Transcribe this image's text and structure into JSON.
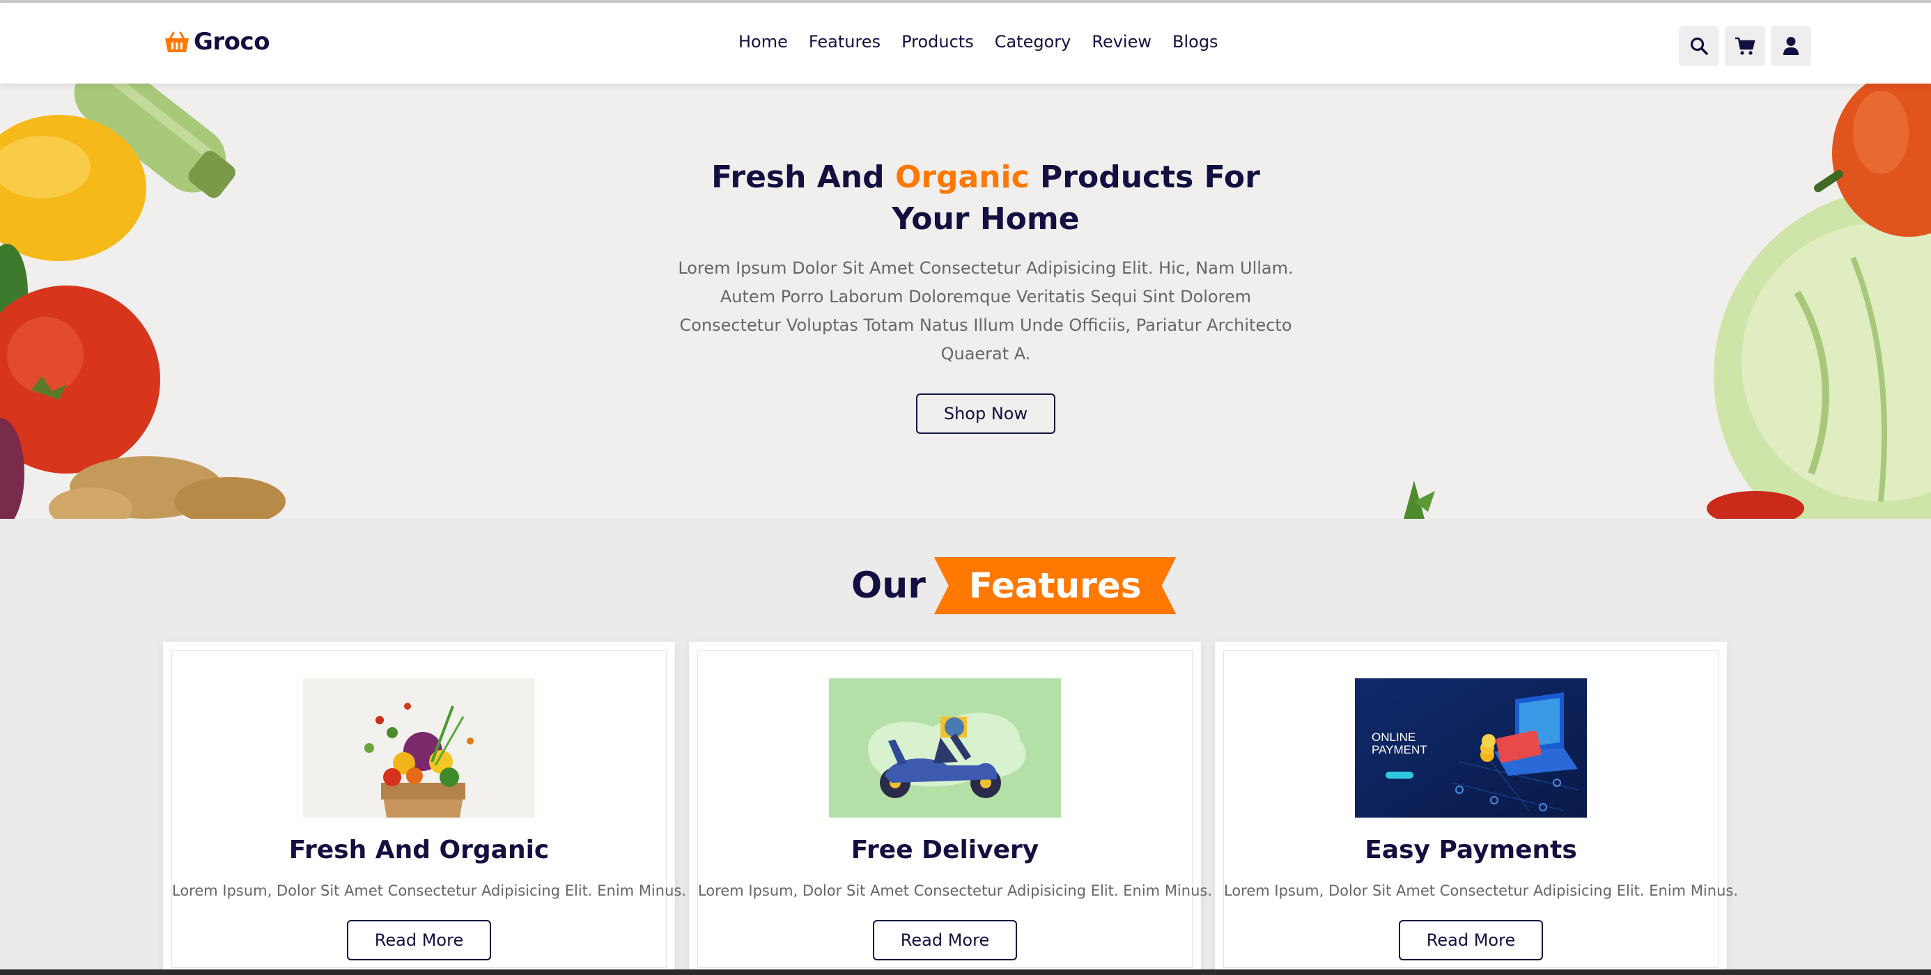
{
  "header": {
    "logo_text": "Groco",
    "nav": [
      "Home",
      "Features",
      "Products",
      "Category",
      "Review",
      "Blogs"
    ],
    "icons": [
      "search-icon",
      "cart-icon",
      "user-icon"
    ]
  },
  "hero": {
    "title_before": "Fresh And ",
    "title_accent": "Organic",
    "title_after": " Products For Your Home",
    "text": "Lorem Ipsum Dolor Sit Amet Consectetur Adipisicing Elit. Hic, Nam Ullam. Autem Porro Laborum Doloremque Veritatis Sequi Sint Dolorem Consectetur Voluptas Totam Natus Illum Unde Officiis, Pariatur Architecto Quaerat A.",
    "button": "Shop Now"
  },
  "features": {
    "heading_plain": "Our",
    "heading_tag": "Features",
    "cards": [
      {
        "title": "Fresh And Organic",
        "text": "Lorem Ipsum, Dolor Sit Amet Consectetur Adipisicing Elit. Enim Minus.",
        "button": "Read More"
      },
      {
        "title": "Free Delivery",
        "text": "Lorem Ipsum, Dolor Sit Amet Consectetur Adipisicing Elit. Enim Minus.",
        "button": "Read More"
      },
      {
        "title": "Easy Payments",
        "text": "Lorem Ipsum, Dolor Sit Amet Consectetur Adipisicing Elit. Enim Minus.",
        "button": "Read More"
      }
    ],
    "payment_image_text": [
      "ONLINE",
      "PAYMENT"
    ]
  },
  "colors": {
    "accent": "#ff7800",
    "dark": "#130f40",
    "text_muted": "#666666"
  }
}
